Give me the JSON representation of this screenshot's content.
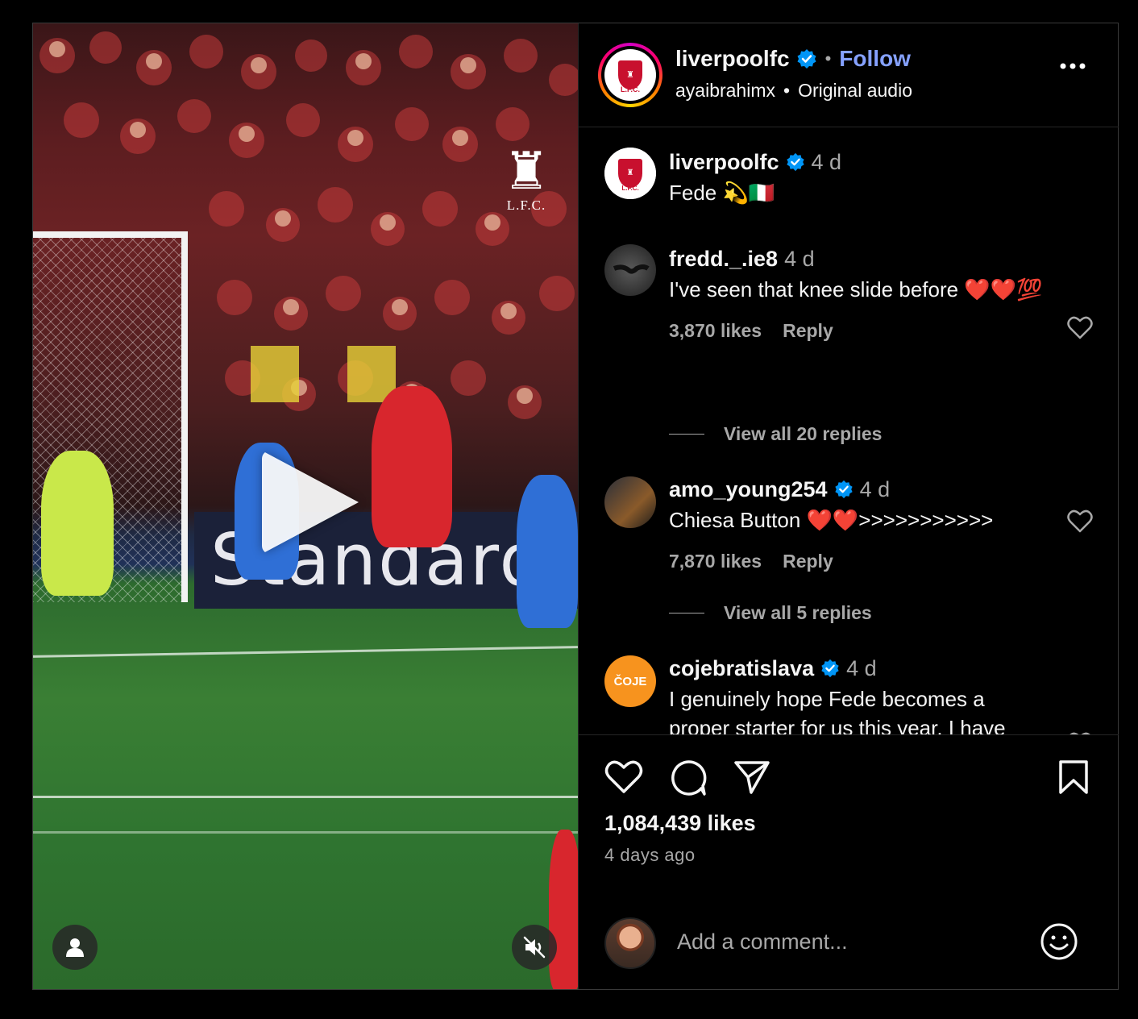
{
  "header": {
    "username": "liverpoolfc",
    "follow_label": "Follow",
    "audio_user": "ayaibrahimx",
    "audio_label": "Original audio"
  },
  "video": {
    "watermark_text": "L.F.C.",
    "board_text": "Standard"
  },
  "caption": {
    "username": "liverpoolfc",
    "time": "4 d",
    "text": "Fede 💫🇮🇹"
  },
  "comments": [
    {
      "username": "fredd._.ie8",
      "verified": false,
      "time": "4 d",
      "text": "I've seen that knee slide before ❤️❤️💯",
      "likes": "3,870 likes",
      "reply_label": "Reply",
      "view_replies": "View all 20 replies"
    },
    {
      "username": "amo_young254",
      "verified": true,
      "time": "4 d",
      "text": "Chiesa Button ❤️❤️>>>>>>>>>>>",
      "likes": "7,870 likes",
      "reply_label": "Reply",
      "view_replies": "View all 5 replies"
    },
    {
      "username": "cojebratislava",
      "verified": true,
      "time": "4 d",
      "avatar_text": "ČOJE",
      "text": "I genuinely hope Fede becomes a proper starter for us this year. I have nothing but huge respect for his"
    }
  ],
  "post": {
    "likes": "1,084,439 likes",
    "time_ago": "4 days ago"
  },
  "add_comment": {
    "placeholder": "Add a comment..."
  },
  "colors": {
    "verified": "#0095f6",
    "follow": "#85a1ff",
    "lfc_red": "#c8102e",
    "coje_orange": "#f7931e"
  }
}
